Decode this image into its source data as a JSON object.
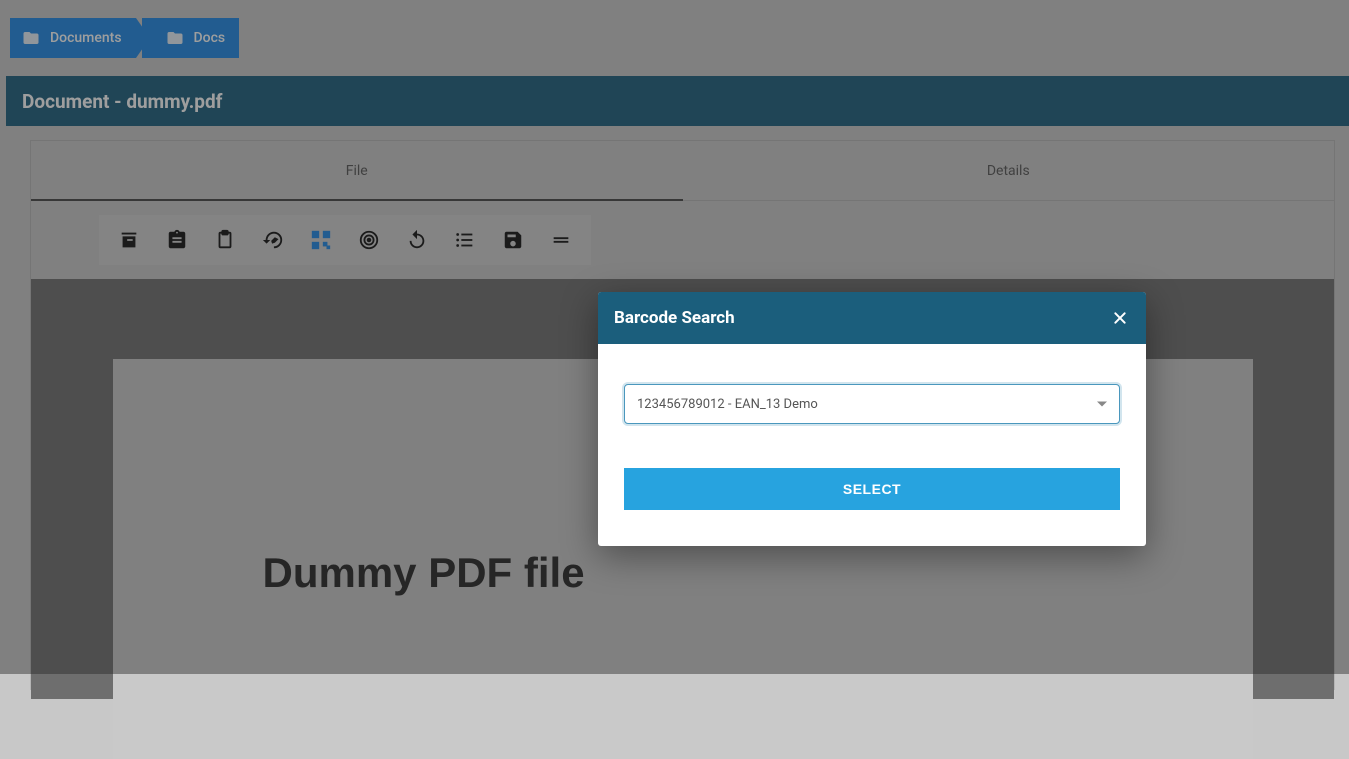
{
  "breadcrumb": {
    "items": [
      {
        "label": "Documents"
      },
      {
        "label": "Docs"
      }
    ]
  },
  "title_bar": "Document - dummy.pdf",
  "tabs": {
    "file": "File",
    "details": "Details"
  },
  "pdf": {
    "heading": "Dummy PDF file"
  },
  "dialog": {
    "title": "Barcode Search",
    "select_value": "123456789012 - EAN_13 Demo",
    "button": "Select"
  },
  "toolbar_icons": [
    "archive",
    "assignment",
    "clipboard",
    "history-edit",
    "qr-scan",
    "target",
    "undo",
    "list",
    "save",
    "drag-handle"
  ]
}
